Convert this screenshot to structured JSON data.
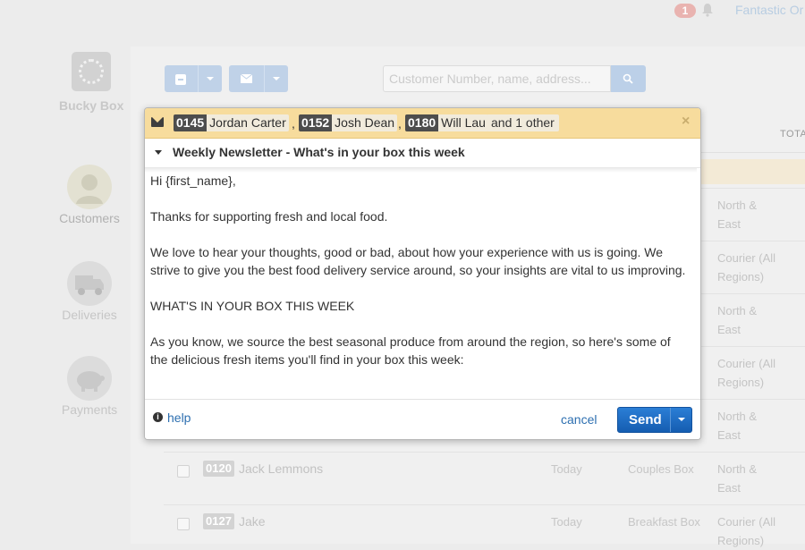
{
  "topbar": {
    "notifications": "1",
    "org_name": "Fantastic Or"
  },
  "sidebar": {
    "logo_text": "Bucky Box",
    "items": [
      {
        "label": "Customers",
        "icon": "customer-icon"
      },
      {
        "label": "Deliveries",
        "icon": "truck-icon"
      },
      {
        "label": "Payments",
        "icon": "piggy-bank-icon"
      }
    ]
  },
  "toolbar": {
    "search_placeholder": "Customer Number, name, address..."
  },
  "table": {
    "total_header": "TOTA",
    "regions": [
      [
        "North &",
        "East"
      ],
      [
        "Courier (All",
        "Regions)"
      ],
      [
        "North &",
        "East"
      ],
      [
        "Courier (All",
        "Regions)"
      ],
      [
        "North &",
        "East"
      ],
      [
        "North &",
        "East"
      ],
      [
        "Courier (All",
        "Regions)"
      ]
    ],
    "rows": [
      {
        "number": "0120",
        "name": "Jack Lemmons",
        "date": "Today",
        "box": "Couples Box"
      },
      {
        "number": "0127",
        "name": "Jake",
        "date": "Today",
        "box": "Breakfast Box"
      }
    ]
  },
  "modal": {
    "recipients": [
      {
        "number": "0145",
        "name": "Jordan Carter"
      },
      {
        "number": "0152",
        "name": "Josh Dean"
      },
      {
        "number": "0180",
        "name": "Will Lau"
      }
    ],
    "separator": ",",
    "others": "and 1 other",
    "close": "×",
    "subject": "Weekly Newsletter - What's in your box this week",
    "body": [
      "Hi {first_name},",
      "Thanks for supporting fresh and local food.",
      "We love to hear your thoughts, good or bad, about how your experience with us is going. We strive to give you the best food delivery service around, so your insights are vital to us improving.",
      "WHAT'S IN YOUR BOX THIS WEEK",
      "As you know, we source the best seasonal produce from around the region, so here's some of the delicious fresh items you'll find in your box this week:"
    ],
    "help": "help",
    "cancel": "cancel",
    "send": "Send"
  }
}
